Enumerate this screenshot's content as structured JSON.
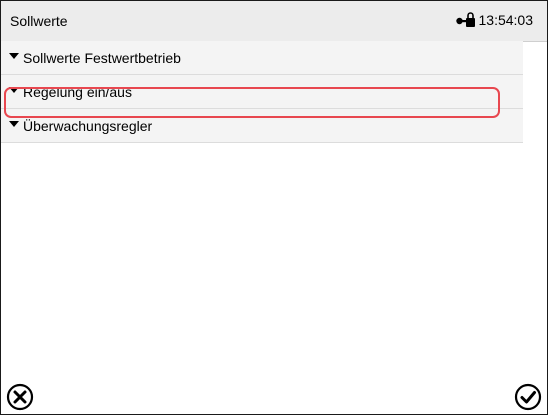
{
  "header": {
    "title": "Sollwerte",
    "time": "13:54:03",
    "lock_icon": "key-lock-icon"
  },
  "menu": {
    "items": [
      {
        "label": "Sollwerte Festwertbetrieb",
        "expanded": false
      },
      {
        "label": "Regelung ein/aus",
        "expanded": false,
        "highlighted": true
      },
      {
        "label": "Überwachungsregler",
        "expanded": false
      }
    ]
  },
  "footer": {
    "cancel_icon": "cancel-circle-icon",
    "confirm_icon": "checkmark-circle-icon"
  },
  "colors": {
    "highlight": "#e8474f",
    "header_bg": "#ececec"
  }
}
